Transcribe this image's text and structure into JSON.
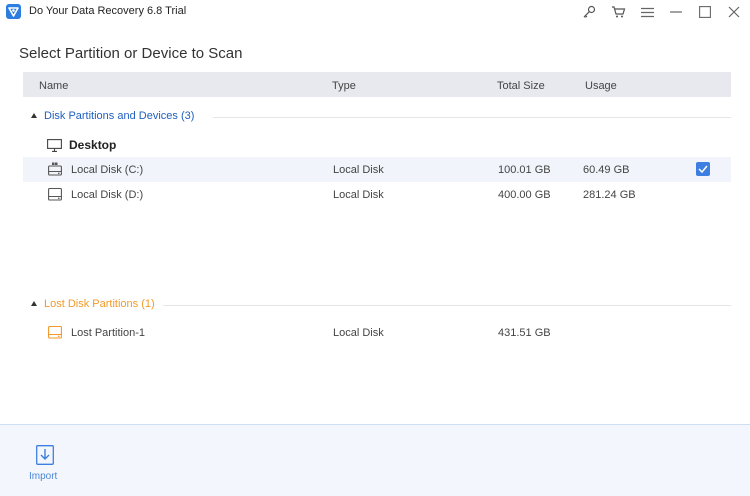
{
  "window": {
    "title": "Do Your Data Recovery 6.8 Trial",
    "controls": [
      "key-icon",
      "cart-icon",
      "menu-icon",
      "minimize-icon",
      "maximize-icon",
      "close-icon"
    ]
  },
  "heading": "Select Partition or Device to Scan",
  "columns": {
    "name": "Name",
    "type": "Type",
    "total_size": "Total Size",
    "usage": "Usage"
  },
  "groups": [
    {
      "label": "Disk Partitions and Devices (3)",
      "color": "#1f5fbf",
      "device": "Desktop",
      "rows": [
        {
          "name": "Local Disk (C:)",
          "type": "Local Disk",
          "total_size": "100.01 GB",
          "usage": "60.49 GB",
          "selected": true
        },
        {
          "name": "Local Disk (D:)",
          "type": "Local Disk",
          "total_size": "400.00 GB",
          "usage": "281.24 GB",
          "selected": false
        }
      ]
    },
    {
      "label": "Lost Disk Partitions (1)",
      "color": "#f09a2a",
      "rows": [
        {
          "name": "Lost Partition-1",
          "type": "Local Disk",
          "total_size": "431.51 GB",
          "usage": "",
          "selected": false
        }
      ]
    }
  ],
  "footer": {
    "import_label": "Import"
  },
  "colors": {
    "accent": "#3d7fe0",
    "lost": "#f09a2a",
    "header_bg": "#e7e9ee",
    "footer_bg": "#f3f7fd"
  }
}
